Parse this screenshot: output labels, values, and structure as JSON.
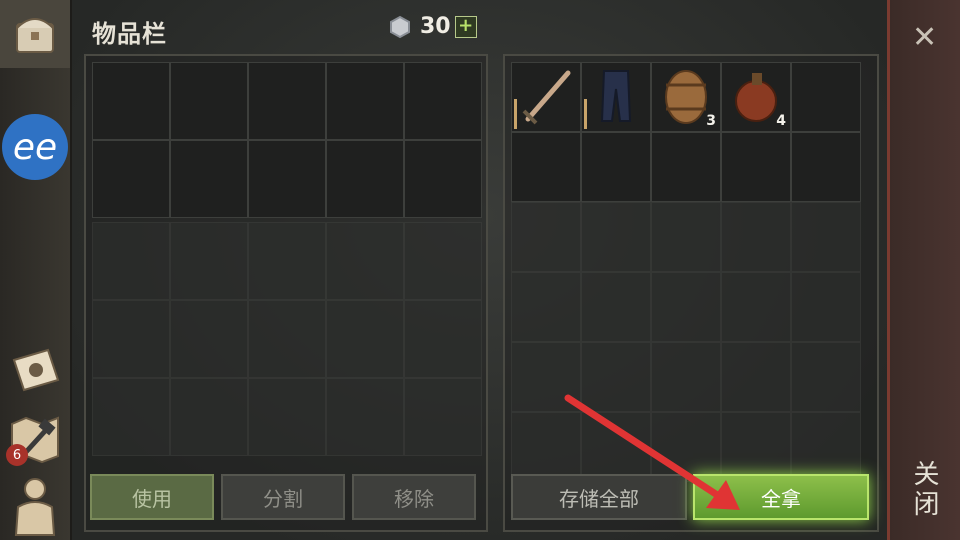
{
  "header": {
    "title": "物品栏",
    "currency_value": "30",
    "plus": "+"
  },
  "sidebar": {
    "badge_count": "6"
  },
  "left_buttons": [
    "使用",
    "分割",
    "移除"
  ],
  "right_buttons": {
    "store_all": "存储全部",
    "take_all": "全拿"
  },
  "close": {
    "x": "✕",
    "label": "关闭"
  },
  "loot_items": [
    {
      "name": "sword",
      "qty": ""
    },
    {
      "name": "pants",
      "qty": ""
    },
    {
      "name": "barrel",
      "qty": "3"
    },
    {
      "name": "flask",
      "qty": "4"
    }
  ]
}
